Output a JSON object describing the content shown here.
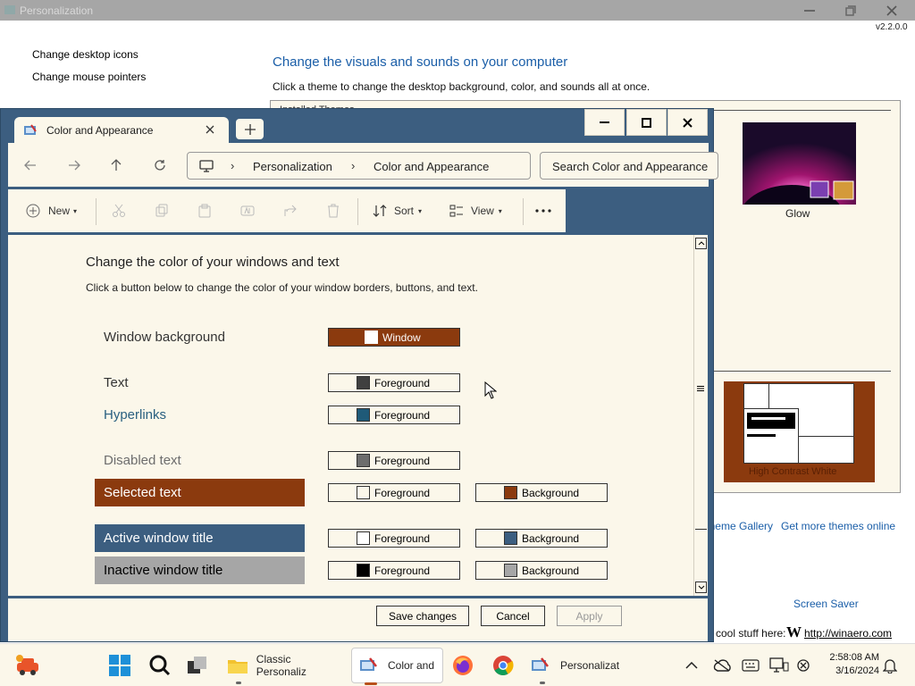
{
  "bg_window": {
    "title": "Personalization",
    "version": "v2.2.0.0",
    "sidebar_links": [
      "Change desktop icons",
      "Change mouse pointers"
    ],
    "heading": "Change the visuals and sounds on your computer",
    "subheading": "Click a theme to change the desktop background, color, and sounds all at once.",
    "section_label": "Installed Themes",
    "theme_glow": "Glow",
    "theme_hc": "High Contrast White",
    "gallery_link": "Theme Gallery",
    "more_themes_link": "Get more themes online",
    "screen_saver": "Screen Saver",
    "cool_stuff": "cool stuff here:",
    "winaero_link": "http://winaero.com"
  },
  "explorer": {
    "tab_title": "Color and Appearance",
    "breadcrumb": [
      "Personalization",
      "Color and Appearance"
    ],
    "search_placeholder": "Search Color and Appearance",
    "toolbar": {
      "new": "New",
      "sort": "Sort",
      "view": "View"
    }
  },
  "content": {
    "title": "Change the color of your windows and text",
    "subtitle": "Click a button below to change the color of your window borders, buttons, and text.",
    "rows": [
      {
        "label": "Window background",
        "button1": "Window",
        "swatch1": "#ffffff"
      },
      {
        "label": "Text",
        "button1": "Foreground",
        "swatch1": "#404040"
      },
      {
        "label": "Hyperlinks",
        "button1": "Foreground",
        "swatch1": "#1f5a78"
      },
      {
        "label": "Disabled text",
        "button1": "Foreground",
        "swatch1": "#6d6d6d"
      },
      {
        "label": "Selected text",
        "button1": "Foreground",
        "swatch1": "#fbf7ea",
        "button2": "Background",
        "swatch2": "#8b3a0e"
      },
      {
        "label": "Active window title",
        "button1": "Foreground",
        "swatch1": "#ffffff",
        "button2": "Background",
        "swatch2": "#3c5e80"
      },
      {
        "label": "Inactive window title",
        "button1": "Foreground",
        "swatch1": "#000000",
        "button2": "Background",
        "swatch2": "#a6a6a6"
      }
    ]
  },
  "footer": {
    "save": "Save changes",
    "cancel": "Cancel",
    "apply": "Apply"
  },
  "taskbar": {
    "apps": [
      "Classic Personaliz",
      "Color and",
      "Personalizat"
    ],
    "time": "2:58:08 AM",
    "date": "3/16/2024"
  },
  "colors": {
    "accent_brown": "#8b3a0e",
    "window_frame": "#3c5e80",
    "inactive_gray": "#a6a6a6",
    "link_blue": "#1a5ea8",
    "hyperlink_teal": "#2a6080",
    "panel_bg": "#fbf7ea"
  },
  "icons": [
    "control-panel-icon",
    "back-arrow-icon",
    "forward-arrow-icon",
    "up-arrow-icon",
    "refresh-icon",
    "monitor-icon",
    "plus-icon",
    "cut-icon",
    "copy-icon",
    "paste-icon",
    "rename-icon",
    "share-icon",
    "delete-icon",
    "sort-icon",
    "view-icon",
    "more-icon",
    "windows-start-icon",
    "search-icon",
    "task-view-icon",
    "folder-icon",
    "firefox-icon",
    "chrome-icon",
    "chevron-up-icon",
    "network-icon",
    "keyboard-icon",
    "notification-bell-icon"
  ]
}
